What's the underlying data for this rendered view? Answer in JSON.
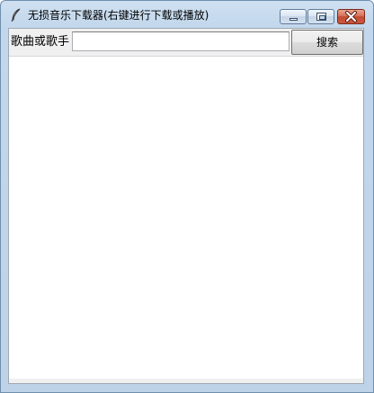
{
  "window": {
    "title": "无损音乐下载器(右键进行下载或播放)",
    "icon": "feather-quill-icon",
    "controls": [
      "minimize-icon",
      "maximize-icon",
      "close-icon"
    ]
  },
  "search": {
    "label": "歌曲或歌手",
    "value": "",
    "placeholder": "",
    "button_label": "搜索"
  },
  "results": {
    "items": []
  },
  "colors": {
    "titlebar": "#c2d7ec",
    "close_button": "#c44b30",
    "client_background": "#f0f0f0",
    "list_background": "#ffffff"
  }
}
